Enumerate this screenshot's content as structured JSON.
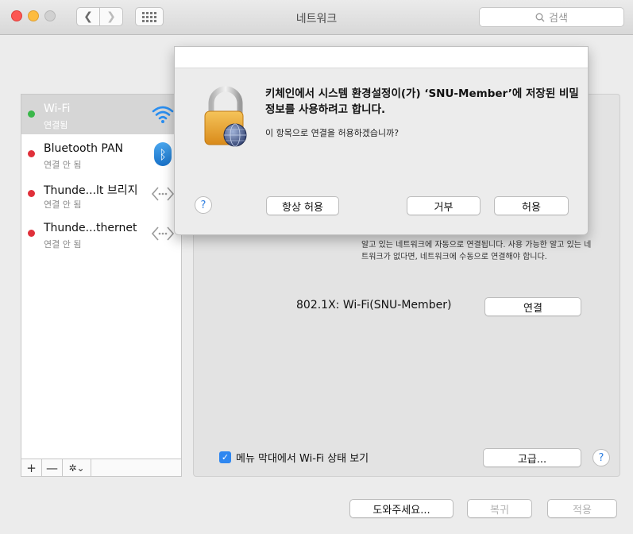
{
  "window": {
    "title": "네트워크"
  },
  "toolbar": {
    "search_placeholder": "검색"
  },
  "sidebar": {
    "items": [
      {
        "name": "Wi-Fi",
        "status": "연결됨",
        "status_color": "#3ab74a"
      },
      {
        "name": "Bluetooth PAN",
        "status": "연결 안 됨",
        "status_color": "#e0303a"
      },
      {
        "name": "Thunde...lt 브리지",
        "status": "연결 안 됨",
        "status_color": "#e0303a"
      },
      {
        "name": "Thunde...thernet",
        "status": "연결 안 됨",
        "status_color": "#e0303a"
      }
    ],
    "add_label": "+",
    "remove_label": "—",
    "gear_label": "✲⌄"
  },
  "dialog": {
    "title": "키체인에서 시스템 환경설정이(가) ‘SNU-Member’에 저장된 비밀 정보를 사용하려고 합니다.",
    "body": "이 항목으로 연결을 허용하겠습니까?",
    "help_label": "?",
    "always_allow_label": "항상 허용",
    "deny_label": "거부",
    "allow_label": "허용"
  },
  "main": {
    "description": "알고 있는 네트워크에 자동으로 연결됩니다. 사용 가능한 알고 있는 네트워크가 없다면, 네트워크에 수동으로 연결해야 합니다.",
    "dot1x_label": "802.1X:  Wi-Fi(SNU-Member)",
    "connect_label": "연결",
    "show_status_label": "메뉴 막대에서 Wi-Fi 상태 보기",
    "advanced_label": "고급...",
    "help_label": "?"
  },
  "footer": {
    "assist_label": "도와주세요...",
    "revert_label": "복귀",
    "apply_label": "적용"
  },
  "colors": {
    "accent": "#2f87f0",
    "close": "#fc5753",
    "minimize": "#fdbc40"
  }
}
